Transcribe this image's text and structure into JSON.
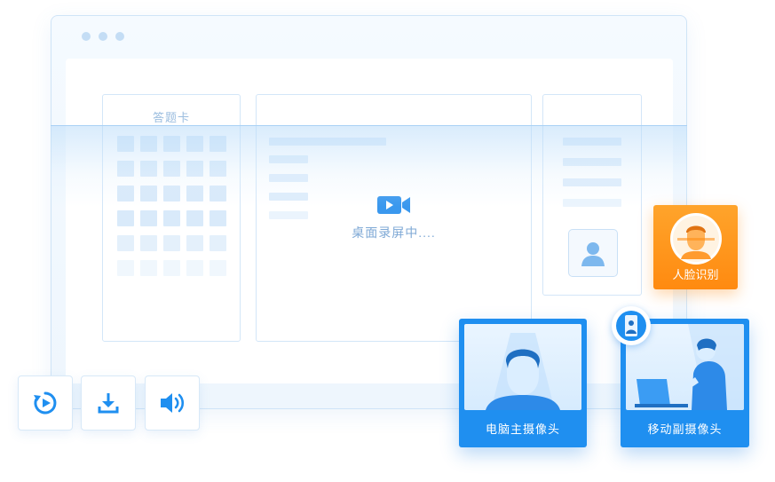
{
  "answer_card": {
    "title": "答题卡"
  },
  "screen_recording": {
    "label": "桌面录屏中...."
  },
  "face_recognition": {
    "label": "人脸识别"
  },
  "cameras": {
    "pc_label": "电脑主摄像头",
    "mobile_label": "移动副摄像头"
  },
  "toolbar": {
    "replay_icon": "replay-icon",
    "download_icon": "download-icon",
    "audio_icon": "speaker-icon"
  },
  "colors": {
    "accent_blue": "#1f8ff0",
    "accent_orange": "#ff8a10",
    "light_blue": "#d9eafa"
  }
}
